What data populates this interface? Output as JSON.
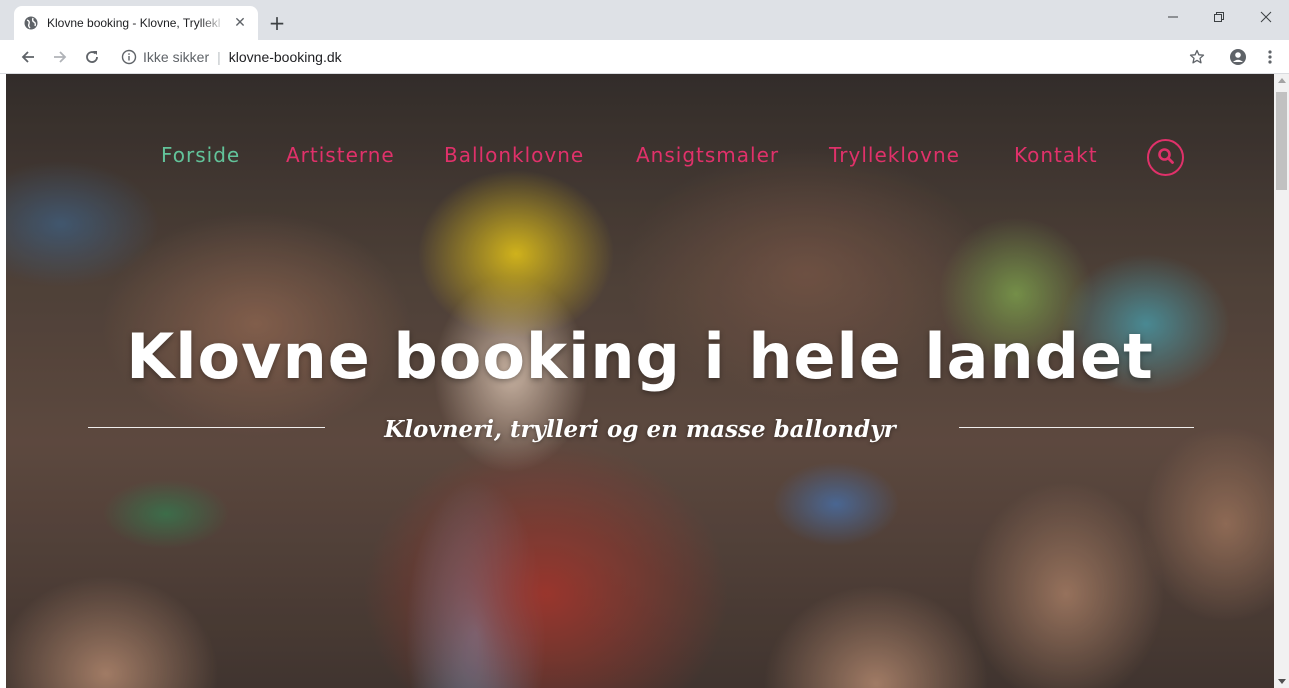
{
  "browser": {
    "tab_title": "Klovne booking - Klovne, Tryllekl",
    "tab_close": "✕",
    "new_tab": "+",
    "security_label": "Ikke sikker",
    "separator": "|",
    "url": "klovne-booking.dk",
    "window_controls": {
      "minimize": "—",
      "restore": "❐",
      "close": "✕"
    }
  },
  "site": {
    "nav": [
      {
        "label": "Forside",
        "active": true
      },
      {
        "label": "Artisterne",
        "active": false
      },
      {
        "label": "Ballonklovne",
        "active": false
      },
      {
        "label": "Ansigtsmaler",
        "active": false
      },
      {
        "label": "Trylleklovne",
        "active": false
      },
      {
        "label": "Kontakt",
        "active": false
      }
    ],
    "search_icon": "search-icon",
    "hero_title": "Klovne booking i hele landet",
    "tagline": "Klovneri, trylleri og en masse ballondyr"
  },
  "colors": {
    "nav_active": "#62c39a",
    "nav_inactive": "#e0316a",
    "hero_text": "#ffffff",
    "tabbar": "#dee1e6"
  },
  "icons": [
    "globe-favicon",
    "back-icon",
    "forward-icon",
    "reload-icon",
    "info-icon",
    "star-icon",
    "account-icon",
    "menu-dots-icon",
    "search-icon"
  ]
}
